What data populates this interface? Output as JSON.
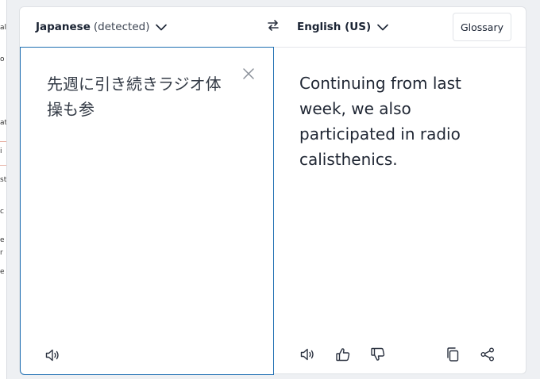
{
  "background": {
    "fragments": [
      "al",
      "o",
      "at",
      "i",
      "st",
      "c",
      "e",
      "r",
      "e"
    ]
  },
  "source": {
    "language": "Japanese",
    "detected_label": "(detected)",
    "text": "先週に引き続きラジオ体操も参"
  },
  "target": {
    "language": "English (US)",
    "text": "Continuing from last week, we also participated in radio calisthenics."
  },
  "header": {
    "glossary_label": "Glossary"
  },
  "icons": {
    "source_lang_dropdown": "chevron-down-icon",
    "target_lang_dropdown": "chevron-down-icon",
    "swap": "swap-arrows-icon",
    "clear": "close-icon",
    "source_listen": "speaker-icon",
    "target_listen": "speaker-icon",
    "like": "thumbs-up-icon",
    "dislike": "thumbs-down-icon",
    "copy": "copy-icon",
    "share": "share-icon"
  },
  "colors": {
    "accent_border": "#1f6fb2",
    "text_primary": "#1a2333",
    "icon": "#2b3240"
  }
}
